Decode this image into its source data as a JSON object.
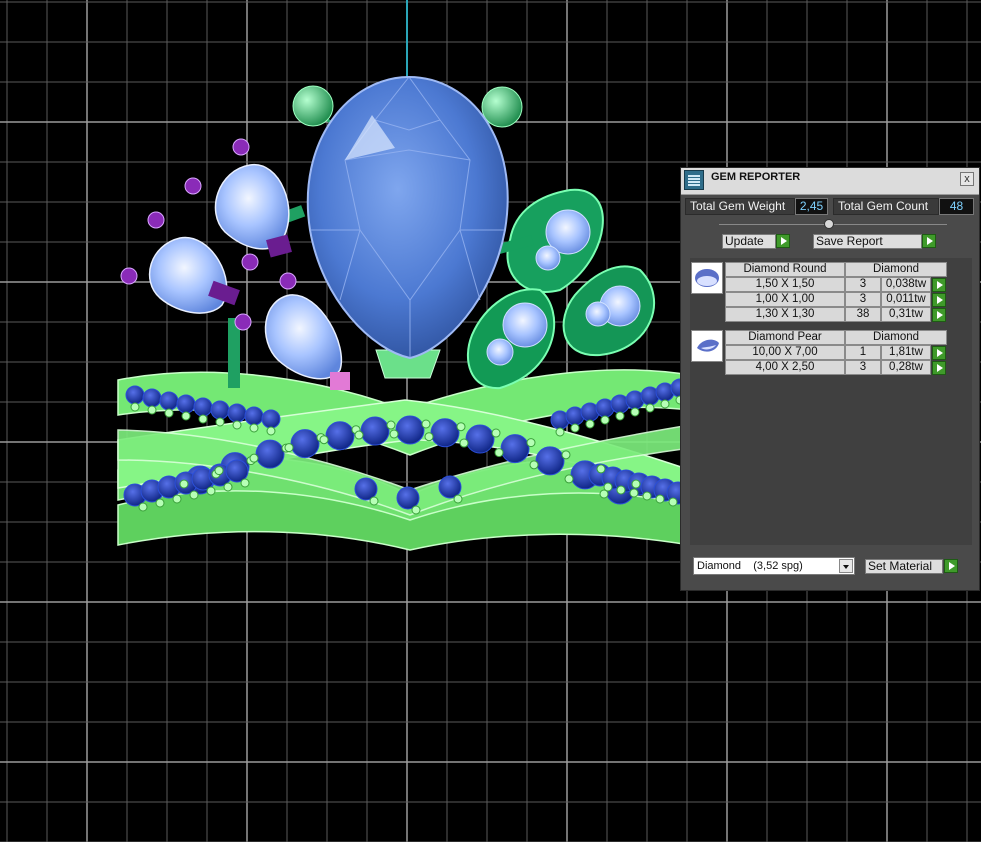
{
  "panel": {
    "title": "GEM REPORTER",
    "close_glyph": "x",
    "total_weight_label": "Total Gem Weight",
    "total_weight_value": "2,45",
    "total_count_label": "Total Gem Count",
    "total_count_value": "48",
    "update_label": "Update",
    "save_report_label": "Save Report",
    "groups": [
      {
        "shape": "Diamond Round",
        "material": "Diamond",
        "icon": "round-gem-icon",
        "rows": [
          {
            "size": "1,50 X 1,50",
            "count": "3",
            "weight": "0,038tw"
          },
          {
            "size": "1,00 X 1,00",
            "count": "3",
            "weight": "0,011tw"
          },
          {
            "size": "1,30 X 1,30",
            "count": "38",
            "weight": "0,31tw"
          }
        ]
      },
      {
        "shape": "Diamond Pear",
        "material": "Diamond",
        "icon": "pear-gem-icon",
        "rows": [
          {
            "size": "10,00 X 7,00",
            "count": "1",
            "weight": "1,81tw"
          },
          {
            "size": "4,00 X 2,50",
            "count": "3",
            "weight": "0,28tw"
          }
        ]
      }
    ],
    "material_select": "Diamond    (3,52 spg)",
    "set_material_label": "Set Material"
  },
  "colors": {
    "background": "#000000",
    "grid": "#6f6f6f",
    "center_stone": "#4f7fd6",
    "side_stones": "#8fb3ff",
    "band": "#7cf27a",
    "setting": "#1fa062",
    "prongs": "#9b2bc6",
    "sapphires": "#1436a8",
    "panel_bg": "#4a4a4a",
    "value_text": "#7fd2ff"
  }
}
